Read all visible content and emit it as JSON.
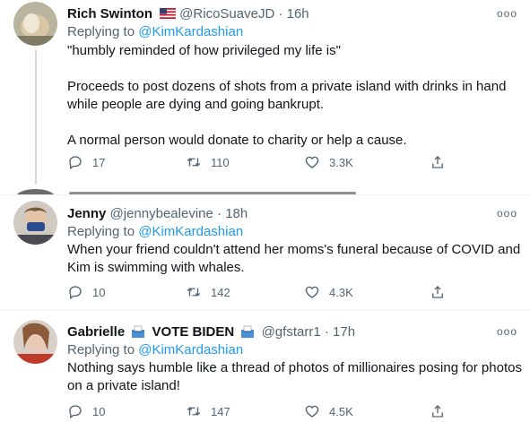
{
  "tweets": [
    {
      "name": "Rich Swinton",
      "handle": "@RicoSuaveJD",
      "time": "16h",
      "replying_prefix": "Replying to ",
      "replying_to": "@KimKardashian",
      "text": "\"humbly reminded of how privileged my life is\"\n\nProceeds to post dozens of shots from a private island with drinks in hand while people are dying and going bankrupt.\n\nA normal person would donate to charity or help a cause.",
      "replies": "17",
      "retweets": "110",
      "likes": "3.3K"
    },
    {
      "name": "Jenny",
      "handle": "@jennybealevine",
      "time": "18h",
      "replying_prefix": "Replying to ",
      "replying_to": "@KimKardashian",
      "text": "When your friend couldn't attend her moms's funeral because of COVID and Kim is swimming with whales.",
      "replies": "10",
      "retweets": "142",
      "likes": "4.3K"
    },
    {
      "name": "Gabrielle",
      "name_suffix": "VOTE BIDEN",
      "handle": "@gfstarr1",
      "time": "17h",
      "replying_prefix": "Replying to ",
      "replying_to": "@KimKardashian",
      "text": "Nothing says humble like a thread of photos of millionaires posing for photos on a private island!",
      "replies": "10",
      "retweets": "147",
      "likes": "4.5K"
    }
  ],
  "more_glyph": "ooo",
  "separator": "·",
  "colors": {
    "accent": "#1d9bf0",
    "muted": "#536471",
    "text": "#0f1419"
  },
  "icons": [
    "reply-icon",
    "retweet-icon",
    "like-icon",
    "share-icon",
    "more-icon",
    "us-flag-icon",
    "ballot-box-icon"
  ]
}
